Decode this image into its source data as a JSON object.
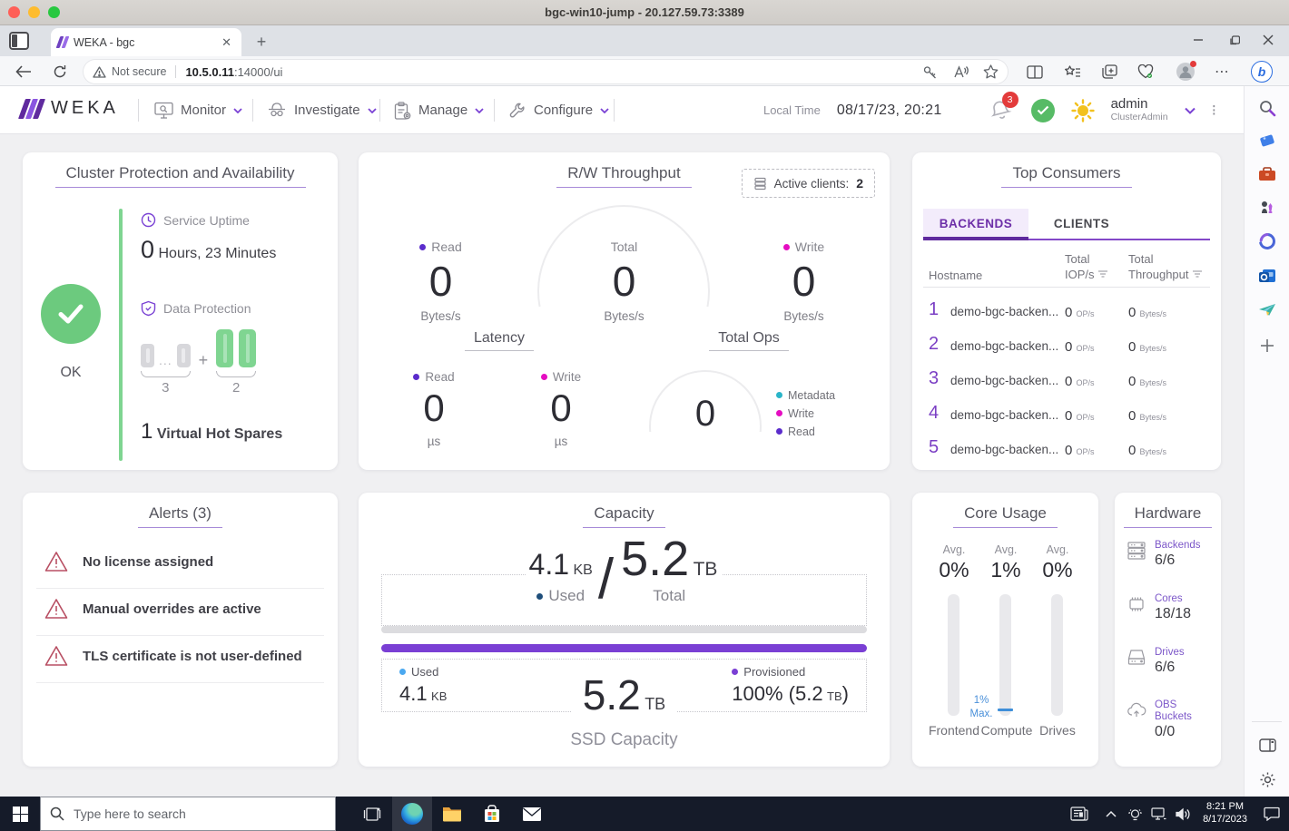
{
  "window": {
    "title": "bgc-win10-jump - 20.127.59.73:3389"
  },
  "browser": {
    "tab_title": "WEKA - bgc",
    "security_label": "Not secure",
    "url_host": "10.5.0.11",
    "url_path": ":14000/ui"
  },
  "nav": {
    "brand": "WEKA",
    "menus": [
      {
        "label": "Monitor"
      },
      {
        "label": "Investigate"
      },
      {
        "label": "Manage"
      },
      {
        "label": "Configure"
      }
    ],
    "local_time_label": "Local Time",
    "local_time_value": "08/17/23, 20:21",
    "alerts_badge": "3",
    "user_name": "admin",
    "user_role": "ClusterAdmin"
  },
  "protection": {
    "title": "Cluster Protection and Availability",
    "status": "OK",
    "uptime_label": "Service Uptime",
    "uptime_value": "0",
    "uptime_text": "Hours, 23 Minutes",
    "dp_label": "Data Protection",
    "dp_dots": "...",
    "dp_plus": "+",
    "dp_data": "3",
    "dp_parity": "2",
    "spares_value": "1",
    "spares_text": "Virtual Hot Spares"
  },
  "throughput": {
    "title": "R/W Throughput",
    "active_clients_label": "Active clients:",
    "active_clients_value": "2",
    "metrics": [
      {
        "label": "Read",
        "value": "0",
        "unit": "Bytes/s"
      },
      {
        "label": "Total",
        "value": "0",
        "unit": "Bytes/s"
      },
      {
        "label": "Write",
        "value": "0",
        "unit": "Bytes/s"
      }
    ],
    "latency_title": "Latency",
    "latency": [
      {
        "label": "Read",
        "value": "0",
        "unit": "µs"
      },
      {
        "label": "Write",
        "value": "0",
        "unit": "µs"
      }
    ],
    "ops_title": "Total Ops",
    "ops_value": "0",
    "ops_legend": [
      {
        "label": "Metadata"
      },
      {
        "label": "Write"
      },
      {
        "label": "Read"
      }
    ]
  },
  "top_consumers": {
    "title": "Top Consumers",
    "tabs": [
      {
        "label": "BACKENDS"
      },
      {
        "label": "CLIENTS"
      }
    ],
    "col_hostname": "Hostname",
    "col_total": "Total",
    "col_iops": "IOP/s",
    "col_throughput": "Throughput",
    "rows": [
      {
        "rank": "1",
        "hostname": "demo-bgc-backen...",
        "iops": "0",
        "iops_unit": "OP/s",
        "tp": "0",
        "tp_unit": "Bytes/s"
      },
      {
        "rank": "2",
        "hostname": "demo-bgc-backen...",
        "iops": "0",
        "iops_unit": "OP/s",
        "tp": "0",
        "tp_unit": "Bytes/s"
      },
      {
        "rank": "3",
        "hostname": "demo-bgc-backen...",
        "iops": "0",
        "iops_unit": "OP/s",
        "tp": "0",
        "tp_unit": "Bytes/s"
      },
      {
        "rank": "4",
        "hostname": "demo-bgc-backen...",
        "iops": "0",
        "iops_unit": "OP/s",
        "tp": "0",
        "tp_unit": "Bytes/s"
      },
      {
        "rank": "5",
        "hostname": "demo-bgc-backen...",
        "iops": "0",
        "iops_unit": "OP/s",
        "tp": "0",
        "tp_unit": "Bytes/s"
      }
    ]
  },
  "alerts": {
    "title": "Alerts (3)",
    "items": [
      {
        "text": "No license assigned"
      },
      {
        "text": "Manual overrides are active"
      },
      {
        "text": "TLS certificate is not user-defined"
      }
    ]
  },
  "capacity": {
    "title": "Capacity",
    "used_value": "4.1",
    "used_unit": "KB",
    "slash": "/",
    "total_value": "5.2",
    "total_unit": "TB",
    "used_label": "Used",
    "total_label": "Total",
    "bottom_used_label": "Used",
    "bottom_used_value": "4.1",
    "bottom_used_unit": "KB",
    "ssd_value": "5.2",
    "ssd_unit": "TB",
    "provisioned_label": "Provisioned",
    "provisioned_value": "100% (5.2",
    "provisioned_unit": "TB",
    "provisioned_close": ")",
    "ssd_label": "SSD Capacity"
  },
  "core_usage": {
    "title": "Core Usage",
    "avg_label": "Avg.",
    "columns": [
      {
        "value": "0%",
        "name": "Frontend"
      },
      {
        "value": "1%",
        "name": "Compute",
        "max_line1": "1%",
        "max_line2": "Max."
      },
      {
        "value": "0%",
        "name": "Drives"
      }
    ]
  },
  "hardware": {
    "title": "Hardware",
    "items": [
      {
        "label": "Backends",
        "value": "6/6"
      },
      {
        "label": "Cores",
        "value": "18/18"
      },
      {
        "label": "Drives",
        "value": "6/6"
      },
      {
        "label": "OBS Buckets",
        "value": "0/0"
      }
    ]
  },
  "taskbar": {
    "search_placeholder": "Type here to search",
    "time": "8:21 PM",
    "date": "8/17/2023"
  },
  "colors": {
    "accent_purple": "#7a3fd4",
    "brand_purple_dark": "#5f2a9e",
    "status_green": "#6cca7e",
    "alert_rose": "#b84f63",
    "read_dot": "#5b2ccc",
    "write_dot": "#e50dc1",
    "metadata_dot": "#2ab5c9",
    "used_dark_blue": "#1f4e7a",
    "used_light_blue": "#4aa8f0",
    "max_blue": "#4a90d9"
  }
}
